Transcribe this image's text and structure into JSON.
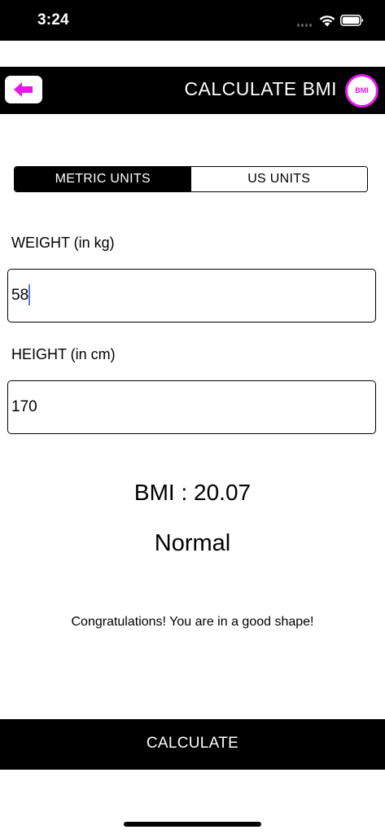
{
  "status_bar": {
    "time": "3:24"
  },
  "header": {
    "title": "CALCULATE BMI",
    "logo_text": "BMI",
    "back_icon": "back-arrow-icon"
  },
  "units": {
    "options": [
      "METRIC UNITS",
      "US UNITS"
    ],
    "selected": "METRIC UNITS"
  },
  "weight": {
    "label": "WEIGHT (in kg)",
    "value": "58"
  },
  "height": {
    "label": "HEIGHT (in cm)",
    "value": "170"
  },
  "result": {
    "bmi_text": "BMI : 20.07",
    "category": "Normal",
    "message": "Congratulations! You are in a good shape!"
  },
  "calculate_label": "CALCULATE",
  "colors": {
    "accent": "#e617e6",
    "bar": "#000000",
    "background": "#ffffff"
  }
}
